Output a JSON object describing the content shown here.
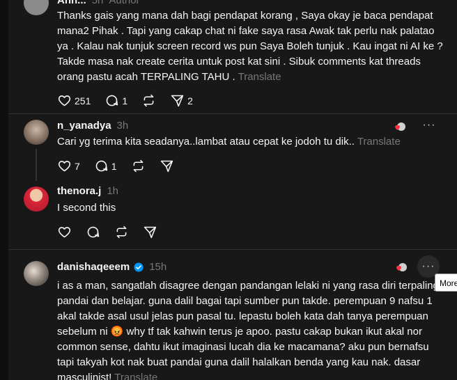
{
  "post_top": {
    "username_partial": "Ahh...",
    "time": "5h",
    "author_tag": "Author",
    "body": "Thanks gais yang mana dah bagi pendapat korang , Saya okay je baca pendapat mana2 Pihak . Tapi yang cakap chat ni fake saya rasa Awak tak perlu nak palatao ya . Kalau nak tunjuk screen record ws pun Saya Boleh tunjuk . Kau ingat ni AI ke ? Takde masa nak create cerita untuk post kat sini . Sibuk comments kat threads orang pastu acah TERPALING TAHU .",
    "translate": "Translate",
    "likes": "251",
    "replies": "1",
    "shares": "2"
  },
  "reply1": {
    "username": "n_yanadya",
    "time": "3h",
    "body": "Cari yg terima kita seadanya..lambat atau cepat ke jodoh tu dik..",
    "translate": "Translate",
    "likes": "7",
    "replies": "1"
  },
  "reply2": {
    "username": "thenora.j",
    "time": "1h",
    "body": "I second this"
  },
  "post_bottom": {
    "username": "danishaqeeem",
    "time": "15h",
    "body": "i as a man, sangatlah disagree dengan pandangan lelaki ni yang rasa diri terpaling pandai dan belajar. guna dalil bagai tapi sumber pun takde. perempuan 9 nafsu 1 akal takde asal usul jelas pun pasal tu. lepastu boleh kata dah tanya perempuan sebelum ni 😡 why tf tak kahwin terus je apoo. pastu cakap bukan ikut akal nor common sense, dahtu ikut imaginasi lucah dia ke macamana? aku pun bernafsu tapi takyah kot nak buat pandai guna dalil halalkan benda yang kau nak. dasar masculinist!",
    "translate": "Translate"
  },
  "tooltip": "More",
  "more_glyph": "···",
  "colors": {
    "background": "#181818",
    "text": "#f3f5f7",
    "muted": "#777777",
    "verified": "#0095f6",
    "like": "#ff3040"
  }
}
